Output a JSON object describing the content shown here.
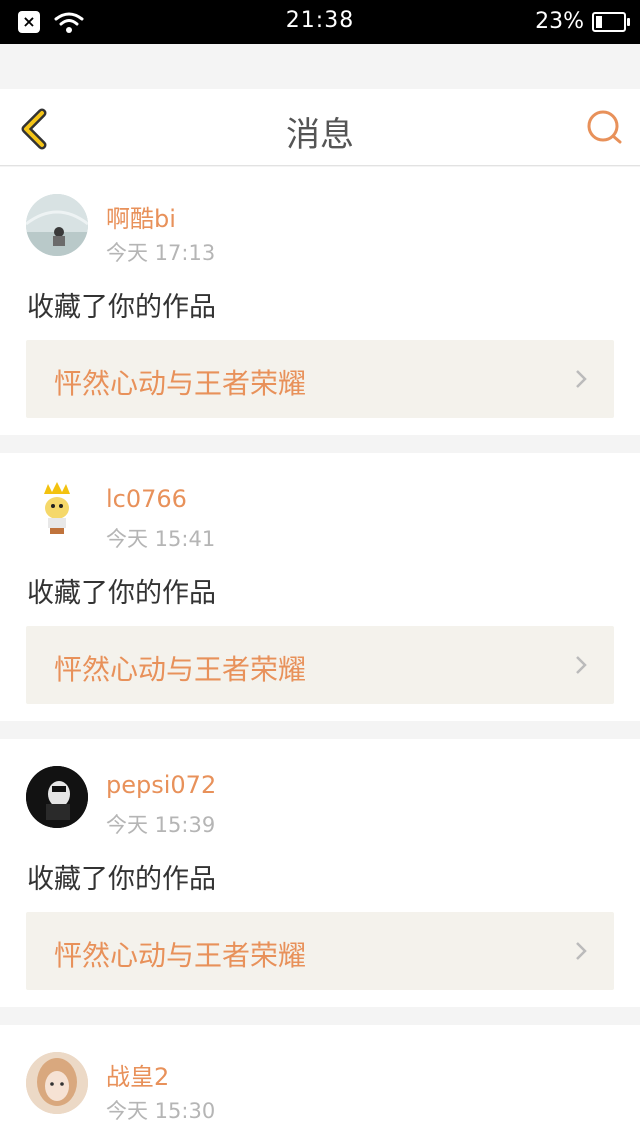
{
  "statusbar": {
    "time": "21:38",
    "battery": "23%",
    "battery_level": 0.23
  },
  "header": {
    "title": "消息"
  },
  "messages": [
    {
      "username": "啊酷bi",
      "time": "今天 17:13",
      "action": "收藏了你的作品",
      "work": "怦然心动与王者荣耀"
    },
    {
      "username": "lc0766",
      "time": "今天 15:41",
      "action": "收藏了你的作品",
      "work": "怦然心动与王者荣耀"
    },
    {
      "username": "pepsi072",
      "time": "今天 15:39",
      "action": "收藏了你的作品",
      "work": "怦然心动与王者荣耀"
    },
    {
      "username": "战皇2",
      "time": "今天 15:30"
    }
  ],
  "colors": {
    "accent": "#e8915a",
    "back_arrow": "#f5c518",
    "work_bg": "#f4f2ec"
  }
}
